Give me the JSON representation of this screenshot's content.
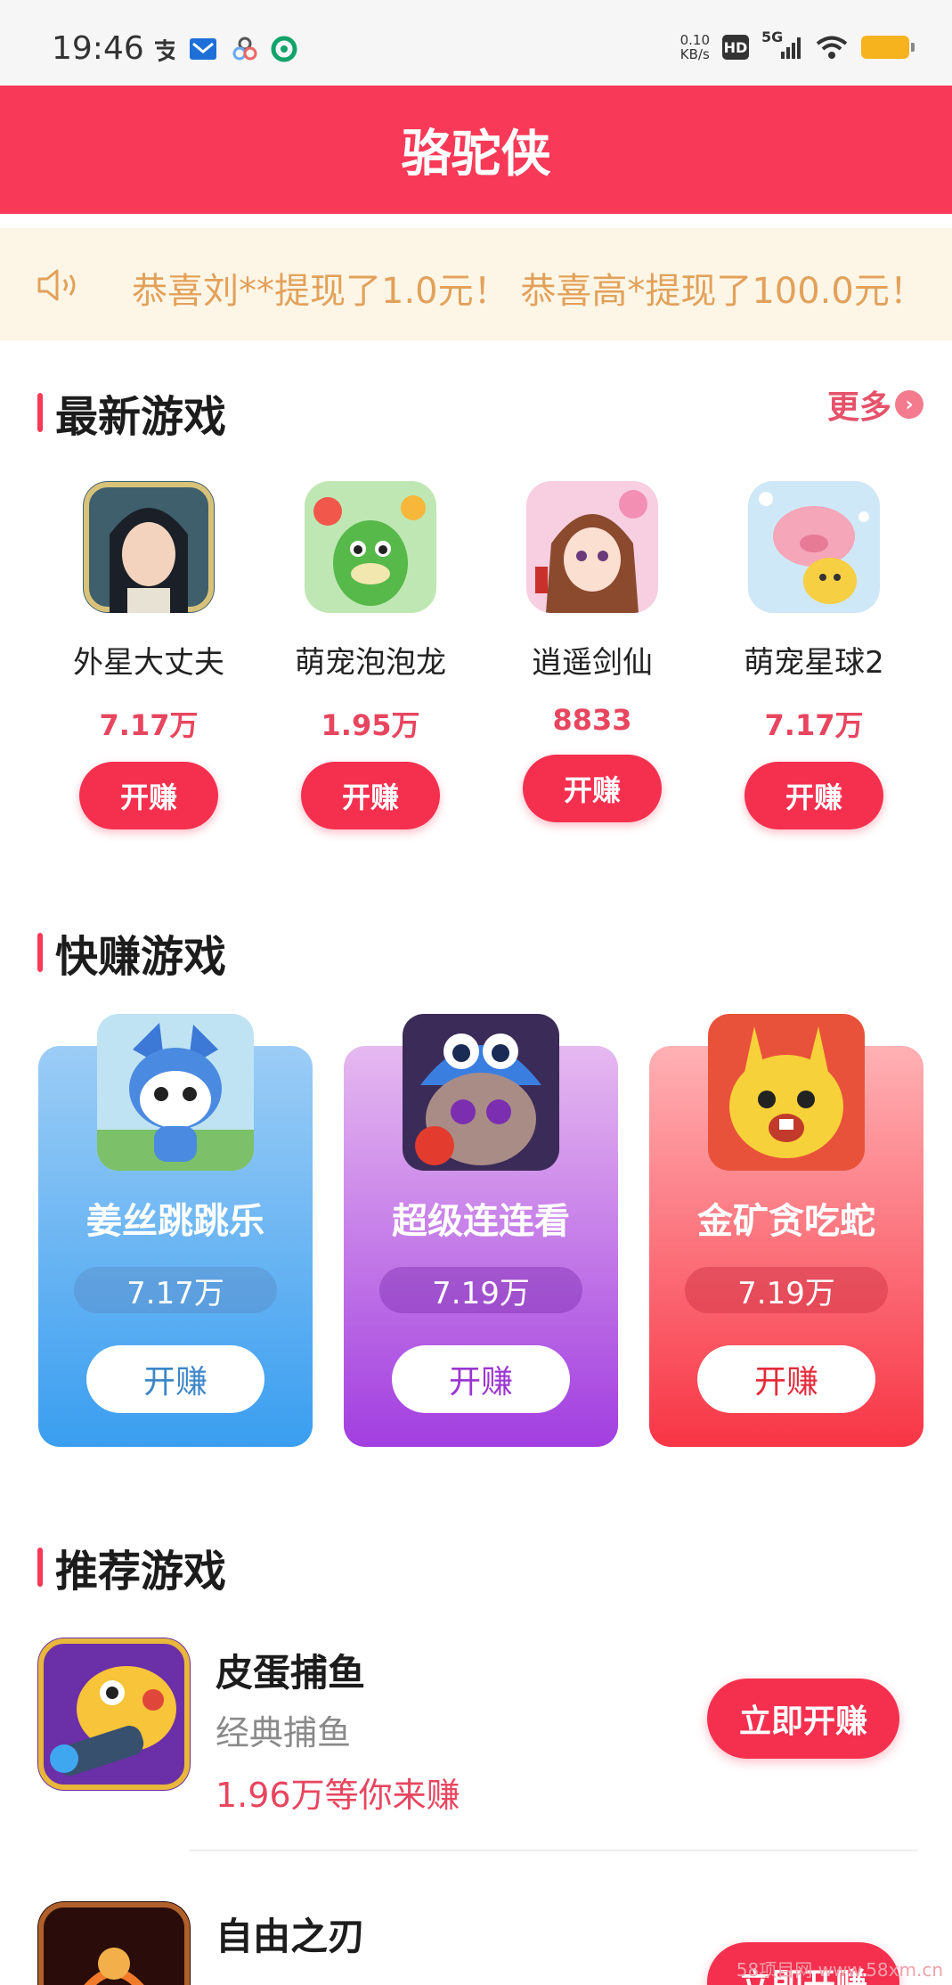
{
  "status_bar": {
    "time": "19:46",
    "net_speed_value": "0.10",
    "net_speed_unit": "KB/s",
    "hd_badge": "HD",
    "network": "5G",
    "icons": [
      "alipay-icon",
      "mail-icon",
      "app-icon",
      "app-icon",
      "wifi-icon",
      "battery-icon"
    ]
  },
  "header": {
    "title": "骆驼侠"
  },
  "notice": {
    "text": "恭喜刘**提现了1.0元！  恭喜高*提现了100.0元！"
  },
  "colors": {
    "accent": "#f83a58",
    "notice_bg": "#fdf6e6",
    "notice_text": "#e2a15a"
  },
  "newest": {
    "title": "最新游戏",
    "more_label": "更多",
    "games": [
      {
        "name": "外星大丈夫",
        "count": "7.17万",
        "button": "开赚"
      },
      {
        "name": "萌宠泡泡龙",
        "count": "1.95万",
        "button": "开赚"
      },
      {
        "name": "逍遥剑仙",
        "count": "8833",
        "button": "开赚"
      },
      {
        "name": "萌宠星球2",
        "count": "7.17万",
        "button": "开赚"
      }
    ]
  },
  "quick": {
    "title": "快赚游戏",
    "games": [
      {
        "name": "姜丝跳跳乐",
        "count": "7.17万",
        "button": "开赚"
      },
      {
        "name": "超级连连看",
        "count": "7.19万",
        "button": "开赚"
      },
      {
        "name": "金矿贪吃蛇",
        "count": "7.19万",
        "button": "开赚"
      }
    ]
  },
  "recommended": {
    "title": "推荐游戏",
    "games": [
      {
        "name": "皮蛋捕鱼",
        "subtitle": "经典捕鱼",
        "earn": "1.96万等你来赚",
        "button": "立即开赚"
      },
      {
        "name": "自由之刃",
        "subtitle": "",
        "earn": "",
        "button": "立即开赚"
      }
    ]
  },
  "watermark": "58项目网 www.58xm.cn"
}
